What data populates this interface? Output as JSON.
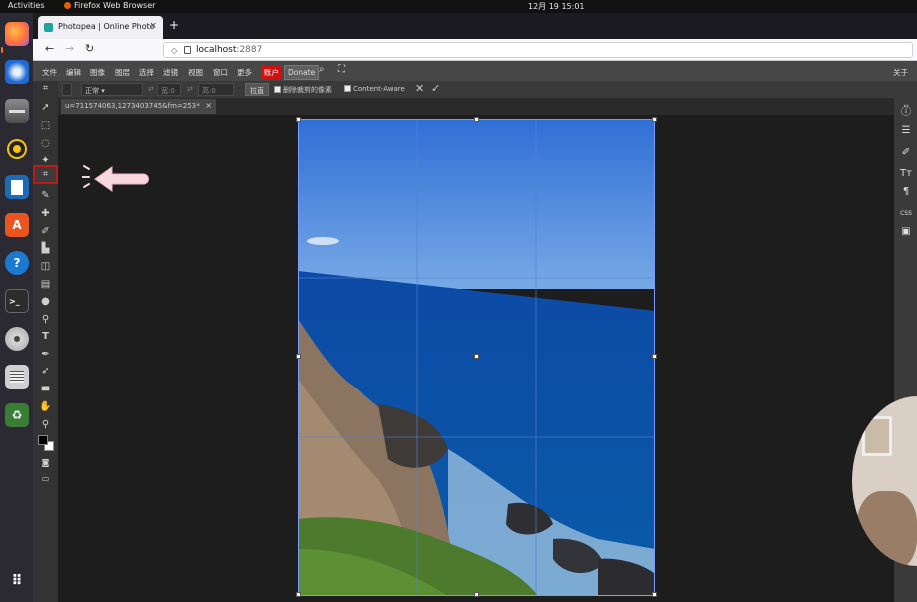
{
  "system": {
    "activities": "Activities",
    "app_name": "Firefox Web Browser",
    "clock": "12月 19  15:01"
  },
  "browser": {
    "tab_title": "Photopea | Online Photo",
    "tab_close": "×",
    "new_tab": "+",
    "url_host": "localhost",
    "url_port": ":2887"
  },
  "dock": {
    "items": [
      "firefox-icon",
      "thunderbird-icon",
      "files-icon",
      "rhythmbox-icon",
      "writer-icon",
      "software-icon",
      "help-icon",
      "terminal-icon",
      "disc-icon",
      "notes-icon",
      "trash-icon",
      "apps-grid-icon"
    ]
  },
  "photopea": {
    "menu": {
      "file": "文件",
      "edit": "编辑",
      "image": "图像",
      "layer": "图层",
      "select": "选择",
      "filter": "滤镜",
      "view": "视图",
      "window": "窗口",
      "more": "更多",
      "account": "账户",
      "donate": "Donate",
      "about": "关于"
    },
    "options": {
      "mode": "正常",
      "width_label": "宽:",
      "width_value": "0",
      "height_label": "高:",
      "height_value": "0",
      "straighten": "拉直",
      "delete_cropped": "删除裁剪的像素",
      "content_aware": "Content-Aware",
      "cancel": "✕",
      "commit": "✓"
    },
    "document_tab": {
      "name": "u=711574063,1273403745&fm=253",
      "modified": "*",
      "close": "×"
    },
    "right_panel": {
      "css_label": "CSS"
    }
  },
  "colors": {
    "accent_red": "#c01818",
    "account_bg": "#d01010"
  }
}
